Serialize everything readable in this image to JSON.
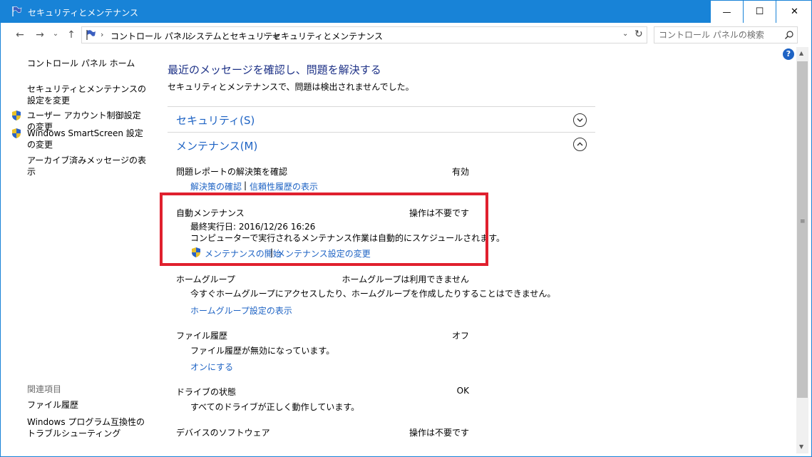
{
  "window": {
    "title": "セキュリティとメンテナンス",
    "minimize_glyph": "—",
    "maximize_glyph": "☐",
    "close_glyph": "✕"
  },
  "nav": {
    "back_glyph": "←",
    "forward_glyph": "→",
    "recent_glyph": "⌄",
    "up_glyph": "↑"
  },
  "address": {
    "crumbs": [
      "コントロール パネル",
      "システムとセキュリティ",
      "セキュリティとメンテナンス"
    ],
    "separator": "›",
    "dropdown_glyph": "⌄",
    "refresh_glyph": "↻"
  },
  "search": {
    "placeholder": "コントロール パネルの検索"
  },
  "help": {
    "glyph": "?"
  },
  "sidebar": {
    "items": [
      {
        "label": "コントロール パネル ホーム"
      },
      {
        "label": "セキュリティとメンテナンスの設定を変更"
      },
      {
        "label": "ユーザー アカウント制御設定の変更"
      },
      {
        "label": "Windows SmartScreen 設定の変更"
      },
      {
        "label": "アーカイブ済みメッセージの表示"
      }
    ],
    "related_heading": "関連項目",
    "related": [
      {
        "label": "ファイル履歴"
      },
      {
        "label": "Windows プログラム互換性のトラブルシューティング"
      }
    ]
  },
  "main": {
    "title": "最近のメッセージを確認し、問題を解決する",
    "subtitle": "セキュリティとメンテナンスで、問題は検出されませんでした。",
    "security_section": "セキュリティ(S)",
    "maintenance_section": "メンテナンス(M)",
    "problem_reports": {
      "label": "問題レポートの解決策を確認",
      "status": "有効",
      "link1": "解決策の確認",
      "link2": "信頼性履歴の表示"
    },
    "auto_maintenance": {
      "label": "自動メンテナンス",
      "status": "操作は不要です",
      "last_run": "最終実行日: 2016/12/26 16:26",
      "desc": "コンピューターで実行されるメンテナンス作業は自動的にスケジュールされます。",
      "link1": "メンテナンスの開始",
      "link2": "メンテナンス設定の変更"
    },
    "homegroup": {
      "label": "ホームグループ",
      "status": "ホームグループは利用できません",
      "desc": "今すぐホームグループにアクセスしたり、ホームグループを作成したりすることはできません。",
      "link": "ホームグループ設定の表示"
    },
    "file_history": {
      "label": "ファイル履歴",
      "status": "オフ",
      "desc": "ファイル履歴が無効になっています。",
      "link": "オンにする"
    },
    "drive_status": {
      "label": "ドライブの状態",
      "status": "OK",
      "desc": "すべてのドライブが正しく動作しています。"
    },
    "device_software": {
      "label": "デバイスのソフトウェア",
      "status": "操作は不要です"
    },
    "link_separator": "|"
  },
  "scrollbar": {
    "up_glyph": "▲",
    "down_glyph": "▼",
    "grip_glyph": "≡"
  },
  "colors": {
    "title_bar": "#1883d7",
    "link": "#1e63c4",
    "heading": "#1e3287",
    "highlight_border": "#e0202e"
  }
}
